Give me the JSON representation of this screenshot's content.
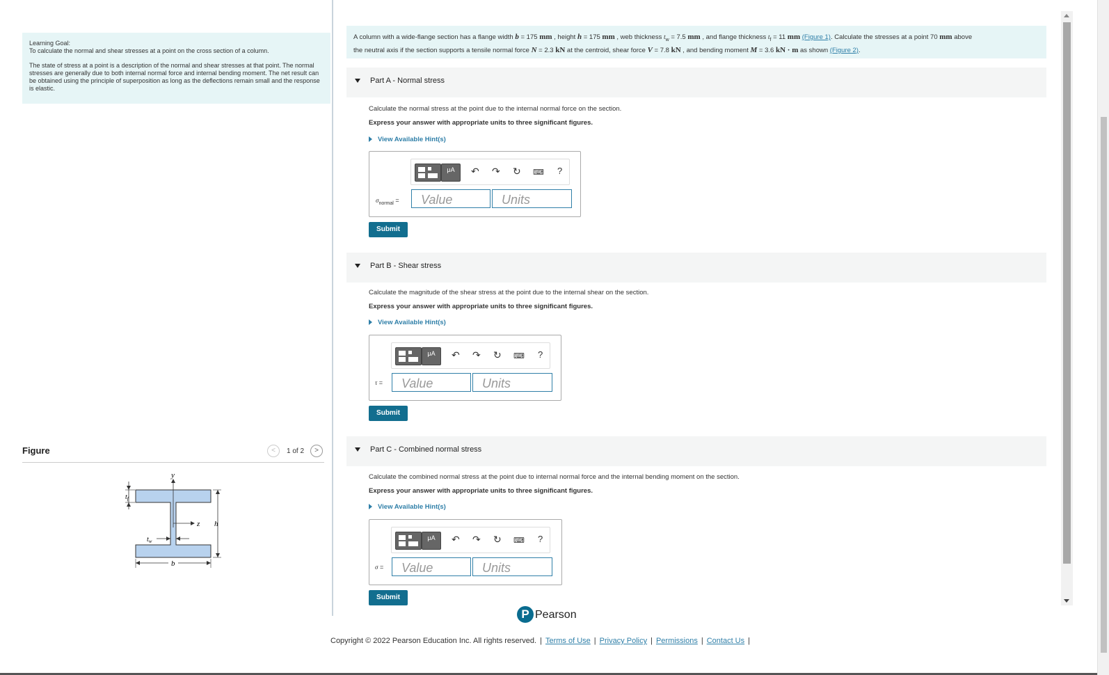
{
  "learning_goal": {
    "title": "Learning Goal:",
    "text": "To calculate the normal and shear stresses at a point on the cross section of a column.",
    "paragraph": "The state of stress at a point is a description of the normal and shear stresses at that point. The normal stresses are generally due to both internal normal force and internal bending moment. The net result can be obtained using the principle of superposition as long as the deflections remain small and the response is elastic."
  },
  "figure": {
    "title": "Figure",
    "pager": "1 of 2",
    "labels": {
      "y": "y",
      "z": "z",
      "h": "h",
      "b": "b",
      "tf": "t",
      "tf_sub": "f",
      "tw": "t",
      "tw_sub": "w"
    }
  },
  "problem": {
    "t1": "A column with a wide-flange section has a flange width ",
    "b_sym": "b",
    "t2": " = 175 ",
    "mm1": "mm",
    "t3": " , height ",
    "h_sym": "h",
    "t4": " = 175 ",
    "mm2": "mm",
    "t5": " , web thickness ",
    "tw_sym": "t",
    "tw_sub": "w",
    "t6": " = 7.5 ",
    "mm3": "mm",
    "t7": " , and flange thickness ",
    "tf_sym": "t",
    "tf_sub": "f",
    "t8": " = 11 ",
    "mm4": "mm",
    "link1": "(Figure 1)",
    "t9": ". Calculate the stresses at a point 70 ",
    "mm5": "mm",
    "t10": " above",
    "t11": "the neutral axis if the section supports a tensile normal force ",
    "N_sym": "N",
    "t12": " = 2.3 ",
    "kN1": "kN",
    "t13": " at the centroid, shear force ",
    "V_sym": "V",
    "t14": " = 7.8 ",
    "kN2": "kN",
    "t15": " , and bending moment ",
    "M_sym": "M",
    "t16": " = 3.6 ",
    "kNm": "kN · m",
    "t17": " as shown ",
    "link2": "(Figure 2)",
    "t18": "."
  },
  "parts": [
    {
      "title": "Part A",
      "subtitle": "Normal stress",
      "instruction": "Calculate the normal stress at the point due to the internal normal force on the section.",
      "express": "Express your answer with appropriate units to three significant figures.",
      "hint": "View Available Hint(s)",
      "symbol": "σ",
      "symbol_sub": "normal",
      "equals": " =",
      "value_placeholder": "Value",
      "units_placeholder": "Units",
      "submit": "Submit"
    },
    {
      "title": "Part B",
      "subtitle": "Shear stress",
      "instruction": "Calculate the magnitude of the shear stress at the point due to the internal shear on the section.",
      "express": "Express your answer with appropriate units to three significant figures.",
      "hint": "View Available Hint(s)",
      "symbol": "τ",
      "equals": " =",
      "value_placeholder": "Value",
      "units_placeholder": "Units",
      "submit": "Submit"
    },
    {
      "title": "Part C",
      "subtitle": "Combined normal stress",
      "instruction": "Calculate the combined normal stress at the point due to internal normal force and the internal bending moment on the section.",
      "express": "Express your answer with appropriate units to three significant figures.",
      "hint": "View Available Hint(s)",
      "symbol": "σ",
      "equals": " =",
      "value_placeholder": "Value",
      "units_placeholder": "Units",
      "submit": "Submit"
    }
  ],
  "toolbar": {
    "mu_label": "μA",
    "help_label": "?"
  },
  "footer": {
    "brand": "Pearson",
    "copyright": "Copyright © 2022 Pearson Education Inc. All rights reserved.",
    "links": [
      "Terms of Use",
      "Privacy Policy",
      "Permissions",
      "Contact Us"
    ]
  },
  "colors": {
    "accent": "#126e8f",
    "link": "#2f7fa8",
    "panel": "#e6f5f6",
    "beam": "#b8d2ee"
  }
}
